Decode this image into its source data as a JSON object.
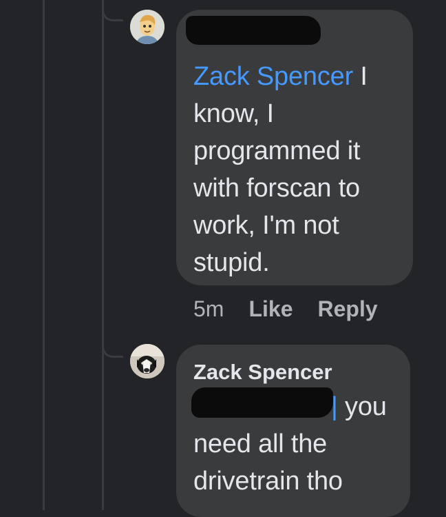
{
  "comments": [
    {
      "mention": "Zack Spencer",
      "text": " I know, I programmed it with forscan to work, I'm not stupid.",
      "time": "5m",
      "like_label": "Like",
      "reply_label": "Reply"
    },
    {
      "author": "Zack Spencer",
      "text": " you need all the drivetrain tho"
    }
  ],
  "colors": {
    "background": "#232427",
    "bubble": "#3a3b3c",
    "mention": "#4599ff",
    "text": "#e4e6eb",
    "meta": "#b0b3b8"
  },
  "icons": {
    "avatar_1": "cartoon-avatar",
    "avatar_2": "dog-photo-avatar"
  }
}
